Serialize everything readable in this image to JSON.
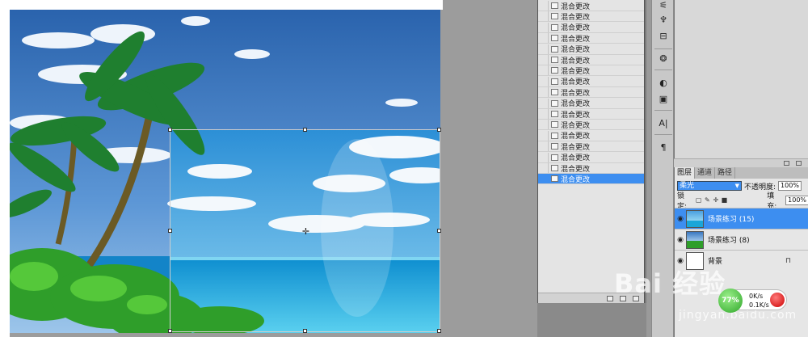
{
  "history": {
    "label": "混合更改",
    "row_count": 17,
    "selected_index": 16
  },
  "layers_panel": {
    "tabs": [
      "图层",
      "通道",
      "路径"
    ],
    "blend_mode": "柔光",
    "opacity_label": "不透明度:",
    "opacity_value": "100%",
    "lock_label": "锁定:",
    "fill_label": "填充:",
    "fill_value": "100%",
    "layers": [
      {
        "name": "场景练习 (15)",
        "selected": true
      },
      {
        "name": "场景练习 (8)",
        "selected": false
      },
      {
        "name": "背景",
        "selected": false
      }
    ]
  },
  "watermark": {
    "brand": "Bai 经验",
    "url": "jingyan.baidu.com"
  },
  "net_widget": {
    "percent": "77%",
    "upload": "0K/s",
    "download": "0.1K/s"
  },
  "colors": {
    "selection": "#3d8ef0",
    "sky_top": "#2f6fb8",
    "sea": "#1aa6d8",
    "foliage": "#2f9e2a"
  }
}
